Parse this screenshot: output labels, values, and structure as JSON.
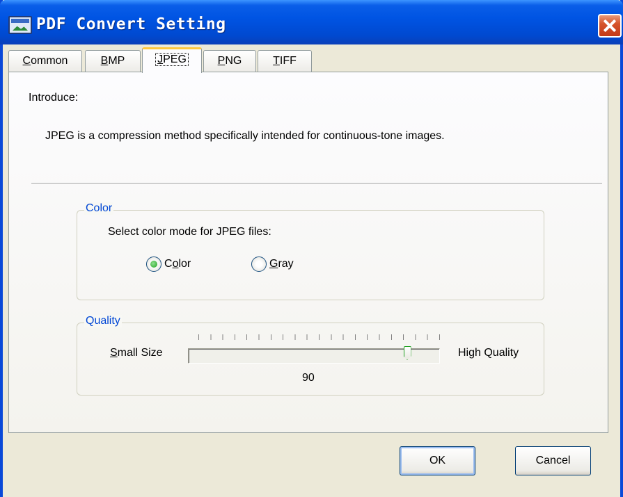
{
  "window": {
    "title": "PDF Convert Setting"
  },
  "tabs": [
    {
      "id": "common",
      "label": "Common",
      "mnemonic": "C",
      "rest": "ommon",
      "active": false
    },
    {
      "id": "bmp",
      "label": "BMP",
      "mnemonic": "B",
      "rest": "MP",
      "active": false
    },
    {
      "id": "jpeg",
      "label": "JPEG",
      "mnemonic": "J",
      "rest": "PEG",
      "active": true
    },
    {
      "id": "png",
      "label": "PNG",
      "mnemonic": "P",
      "rest": "NG",
      "active": false
    },
    {
      "id": "tiff",
      "label": "TIFF",
      "mnemonic": "T",
      "rest": "IFF",
      "active": false
    }
  ],
  "intro": {
    "label": "Introduce:",
    "text": "JPEG is a compression method specifically intended for continuous-tone images."
  },
  "color_group": {
    "legend": "Color",
    "prompt": "Select color mode for JPEG files:",
    "options": [
      {
        "label": "Color",
        "pre": "C",
        "mnemonic": "o",
        "post": "lor",
        "checked": true
      },
      {
        "label": "Gray",
        "pre": "",
        "mnemonic": "G",
        "post": "ray",
        "checked": false
      }
    ]
  },
  "quality_group": {
    "legend": "Quality",
    "min_label_mnemonic": "S",
    "min_label_rest": "mall Size",
    "max_label": "High Quality",
    "value": 90,
    "value_text": "90",
    "min": 0,
    "max": 100
  },
  "buttons": {
    "ok": "OK",
    "cancel": "Cancel"
  }
}
